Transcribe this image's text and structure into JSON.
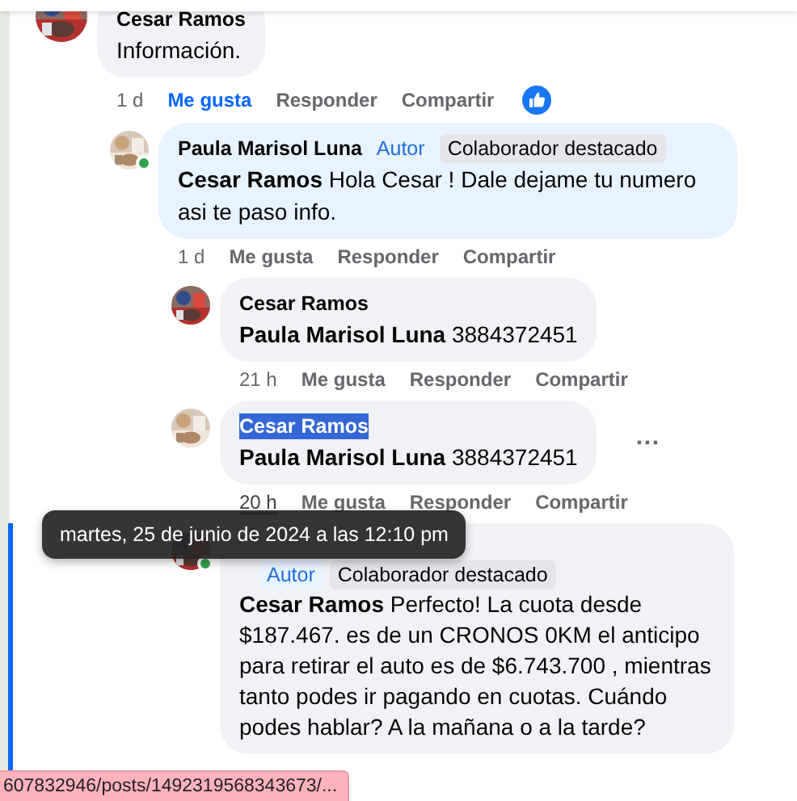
{
  "comments": [
    {
      "author": "Cesar Ramos",
      "name_selected": false,
      "online": false,
      "highlighted": false,
      "focused": false,
      "text": "Información.",
      "actions": {
        "time": "1 d",
        "time_hovered": false,
        "like": "Me gusta",
        "liked": true,
        "reply": "Responder",
        "share": "Compartir",
        "like_reaction": true
      },
      "children": [
        {
          "author": "Paula Marisol Luna",
          "name_selected": false,
          "online": true,
          "highlighted": true,
          "focused": false,
          "badges": [
            {
              "kind": "author",
              "label": "Autor"
            },
            {
              "kind": "featured",
              "label": "Colaborador destacado"
            }
          ],
          "text": "**Cesar Ramos** Hola Cesar ! Dale dejame tu numero asi te paso info.",
          "actions": {
            "time": "1 d",
            "time_hovered": false,
            "like": "Me gusta",
            "liked": false,
            "reply": "Responder",
            "share": "Compartir",
            "like_reaction": false
          },
          "children": [
            {
              "author": "Cesar Ramos",
              "name_selected": false,
              "online": false,
              "highlighted": false,
              "focused": false,
              "text": "**Paula Marisol Luna** 3884372451",
              "actions": {
                "time": "21 h",
                "time_hovered": false,
                "like": "Me gusta",
                "liked": false,
                "reply": "Responder",
                "share": "Compartir",
                "like_reaction": false
              }
            },
            {
              "author": "Cesar Ramos",
              "name_selected": true,
              "online": false,
              "highlighted": false,
              "focused": false,
              "text": "**Paula Marisol Luna** 3884372451",
              "actions": {
                "time": "20 h",
                "time_hovered": true,
                "like": "Me gusta",
                "liked": false,
                "reply": "Responder",
                "share": "Compartir",
                "like_reaction": false
              },
              "menu_icon": "···"
            },
            {
              "online": true,
              "highlighted": false,
              "focused": true,
              "badges": [
                {
                  "kind": "author",
                  "label": "Autor"
                },
                {
                  "kind": "featured",
                  "label": "Colaborador destacado"
                }
              ],
              "text": "**Cesar Ramos** Perfecto! La cuota desde $187.467. es de un CRONOS 0KM el anticipo para retirar el auto es de $6.743.700 , mientras tanto podes ir pagando en cuotas. Cuándo podes hablar? A la mañana o a la tarde?"
            }
          ]
        }
      ]
    }
  ],
  "tooltip": "martes, 25 de junio de 2024 a las 12:10 pm",
  "status_bar": "607832946/posts/1492319568343673/..."
}
